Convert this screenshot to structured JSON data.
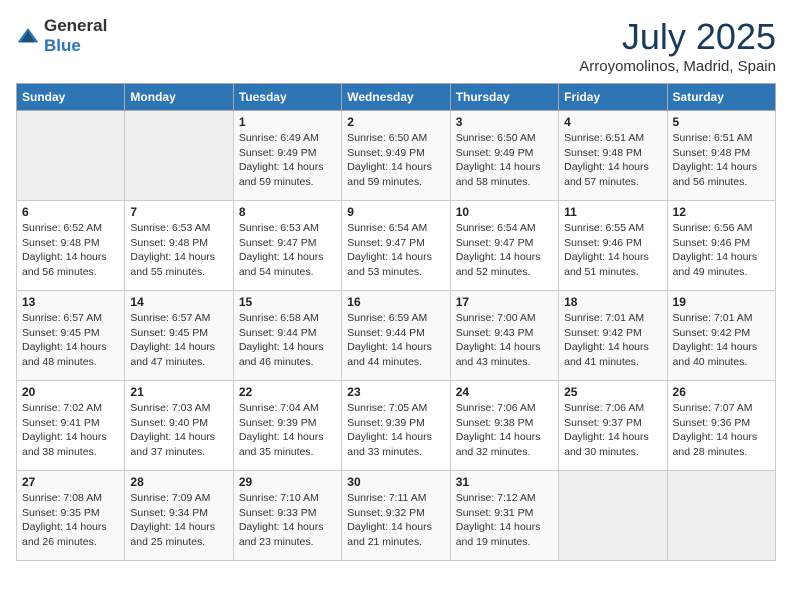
{
  "logo": {
    "general": "General",
    "blue": "Blue"
  },
  "title": {
    "month_year": "July 2025",
    "location": "Arroyomolinos, Madrid, Spain"
  },
  "weekdays": [
    "Sunday",
    "Monday",
    "Tuesday",
    "Wednesday",
    "Thursday",
    "Friday",
    "Saturday"
  ],
  "weeks": [
    [
      {
        "day": null
      },
      {
        "day": null
      },
      {
        "day": 1,
        "sunrise": "Sunrise: 6:49 AM",
        "sunset": "Sunset: 9:49 PM",
        "daylight": "Daylight: 14 hours and 59 minutes."
      },
      {
        "day": 2,
        "sunrise": "Sunrise: 6:50 AM",
        "sunset": "Sunset: 9:49 PM",
        "daylight": "Daylight: 14 hours and 59 minutes."
      },
      {
        "day": 3,
        "sunrise": "Sunrise: 6:50 AM",
        "sunset": "Sunset: 9:49 PM",
        "daylight": "Daylight: 14 hours and 58 minutes."
      },
      {
        "day": 4,
        "sunrise": "Sunrise: 6:51 AM",
        "sunset": "Sunset: 9:48 PM",
        "daylight": "Daylight: 14 hours and 57 minutes."
      },
      {
        "day": 5,
        "sunrise": "Sunrise: 6:51 AM",
        "sunset": "Sunset: 9:48 PM",
        "daylight": "Daylight: 14 hours and 56 minutes."
      }
    ],
    [
      {
        "day": 6,
        "sunrise": "Sunrise: 6:52 AM",
        "sunset": "Sunset: 9:48 PM",
        "daylight": "Daylight: 14 hours and 56 minutes."
      },
      {
        "day": 7,
        "sunrise": "Sunrise: 6:53 AM",
        "sunset": "Sunset: 9:48 PM",
        "daylight": "Daylight: 14 hours and 55 minutes."
      },
      {
        "day": 8,
        "sunrise": "Sunrise: 6:53 AM",
        "sunset": "Sunset: 9:47 PM",
        "daylight": "Daylight: 14 hours and 54 minutes."
      },
      {
        "day": 9,
        "sunrise": "Sunrise: 6:54 AM",
        "sunset": "Sunset: 9:47 PM",
        "daylight": "Daylight: 14 hours and 53 minutes."
      },
      {
        "day": 10,
        "sunrise": "Sunrise: 6:54 AM",
        "sunset": "Sunset: 9:47 PM",
        "daylight": "Daylight: 14 hours and 52 minutes."
      },
      {
        "day": 11,
        "sunrise": "Sunrise: 6:55 AM",
        "sunset": "Sunset: 9:46 PM",
        "daylight": "Daylight: 14 hours and 51 minutes."
      },
      {
        "day": 12,
        "sunrise": "Sunrise: 6:56 AM",
        "sunset": "Sunset: 9:46 PM",
        "daylight": "Daylight: 14 hours and 49 minutes."
      }
    ],
    [
      {
        "day": 13,
        "sunrise": "Sunrise: 6:57 AM",
        "sunset": "Sunset: 9:45 PM",
        "daylight": "Daylight: 14 hours and 48 minutes."
      },
      {
        "day": 14,
        "sunrise": "Sunrise: 6:57 AM",
        "sunset": "Sunset: 9:45 PM",
        "daylight": "Daylight: 14 hours and 47 minutes."
      },
      {
        "day": 15,
        "sunrise": "Sunrise: 6:58 AM",
        "sunset": "Sunset: 9:44 PM",
        "daylight": "Daylight: 14 hours and 46 minutes."
      },
      {
        "day": 16,
        "sunrise": "Sunrise: 6:59 AM",
        "sunset": "Sunset: 9:44 PM",
        "daylight": "Daylight: 14 hours and 44 minutes."
      },
      {
        "day": 17,
        "sunrise": "Sunrise: 7:00 AM",
        "sunset": "Sunset: 9:43 PM",
        "daylight": "Daylight: 14 hours and 43 minutes."
      },
      {
        "day": 18,
        "sunrise": "Sunrise: 7:01 AM",
        "sunset": "Sunset: 9:42 PM",
        "daylight": "Daylight: 14 hours and 41 minutes."
      },
      {
        "day": 19,
        "sunrise": "Sunrise: 7:01 AM",
        "sunset": "Sunset: 9:42 PM",
        "daylight": "Daylight: 14 hours and 40 minutes."
      }
    ],
    [
      {
        "day": 20,
        "sunrise": "Sunrise: 7:02 AM",
        "sunset": "Sunset: 9:41 PM",
        "daylight": "Daylight: 14 hours and 38 minutes."
      },
      {
        "day": 21,
        "sunrise": "Sunrise: 7:03 AM",
        "sunset": "Sunset: 9:40 PM",
        "daylight": "Daylight: 14 hours and 37 minutes."
      },
      {
        "day": 22,
        "sunrise": "Sunrise: 7:04 AM",
        "sunset": "Sunset: 9:39 PM",
        "daylight": "Daylight: 14 hours and 35 minutes."
      },
      {
        "day": 23,
        "sunrise": "Sunrise: 7:05 AM",
        "sunset": "Sunset: 9:39 PM",
        "daylight": "Daylight: 14 hours and 33 minutes."
      },
      {
        "day": 24,
        "sunrise": "Sunrise: 7:06 AM",
        "sunset": "Sunset: 9:38 PM",
        "daylight": "Daylight: 14 hours and 32 minutes."
      },
      {
        "day": 25,
        "sunrise": "Sunrise: 7:06 AM",
        "sunset": "Sunset: 9:37 PM",
        "daylight": "Daylight: 14 hours and 30 minutes."
      },
      {
        "day": 26,
        "sunrise": "Sunrise: 7:07 AM",
        "sunset": "Sunset: 9:36 PM",
        "daylight": "Daylight: 14 hours and 28 minutes."
      }
    ],
    [
      {
        "day": 27,
        "sunrise": "Sunrise: 7:08 AM",
        "sunset": "Sunset: 9:35 PM",
        "daylight": "Daylight: 14 hours and 26 minutes."
      },
      {
        "day": 28,
        "sunrise": "Sunrise: 7:09 AM",
        "sunset": "Sunset: 9:34 PM",
        "daylight": "Daylight: 14 hours and 25 minutes."
      },
      {
        "day": 29,
        "sunrise": "Sunrise: 7:10 AM",
        "sunset": "Sunset: 9:33 PM",
        "daylight": "Daylight: 14 hours and 23 minutes."
      },
      {
        "day": 30,
        "sunrise": "Sunrise: 7:11 AM",
        "sunset": "Sunset: 9:32 PM",
        "daylight": "Daylight: 14 hours and 21 minutes."
      },
      {
        "day": 31,
        "sunrise": "Sunrise: 7:12 AM",
        "sunset": "Sunset: 9:31 PM",
        "daylight": "Daylight: 14 hours and 19 minutes."
      },
      {
        "day": null
      },
      {
        "day": null
      }
    ]
  ]
}
